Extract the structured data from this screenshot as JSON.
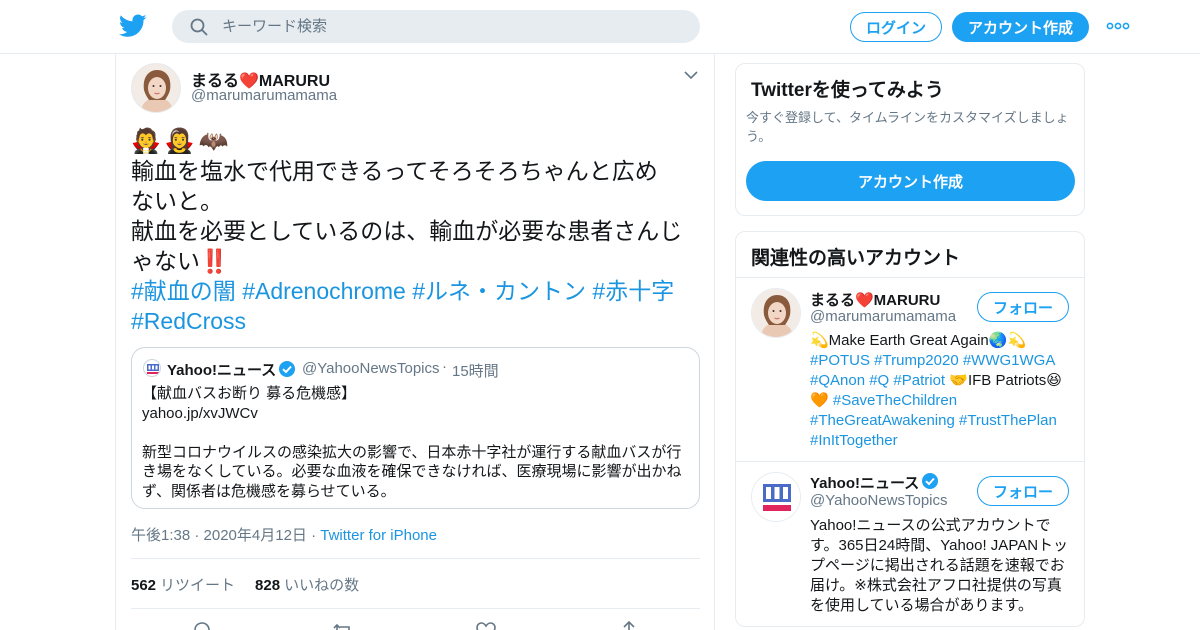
{
  "header": {
    "search_placeholder": "キーワード検索",
    "login_label": "ログイン",
    "signup_label": "アカウント作成",
    "brand_color": "#1da1f2"
  },
  "tweet": {
    "author_name": "まるる❤️MARURU",
    "author_handle": "@marumarumamama",
    "emojis": [
      "🧛",
      "🧛‍♀️",
      "🦇"
    ],
    "text_lines": [
      "輸血を塩水で代用できるってそろそろちゃんと広め",
      "ないと。",
      "献血を必要としているのは、輸血が必要な患者さんじ",
      "ゃない"
    ],
    "exclaim": "‼️",
    "hashtags_line1": [
      "#献血の闇",
      "#Adrenochrome",
      "#ルネ・カントン",
      "#赤十字"
    ],
    "hashtags_line2": [
      "#RedCross"
    ],
    "quote": {
      "name": "Yahoo!ニュース",
      "handle": "@YahooNewsTopics",
      "dot": "·",
      "time": "15時間",
      "body_lines": [
        "【献血バスお断り 募る危機感】",
        "yahoo.jp/xvJWCv",
        "",
        "新型コロナウイルスの感染拡大の影響で、日本赤十字社が運行する献血バスが行",
        "き場をなくしている。必要な血液を確保できなければ、医療現場に影響が出かね",
        "ず、関係者は危機感を募らせている。"
      ]
    },
    "timestamp": "午後1:38 · 2020年4月12日 · ",
    "source": "Twitter for iPhone",
    "retweets": "562",
    "retweets_label": "リツイート",
    "likes": "828",
    "likes_label": "いいねの数"
  },
  "sidebar": {
    "try_card": {
      "title": "Twitterを使ってみよう",
      "desc": "今すぐ登録して、タイムラインをカスタマイズしましょう。",
      "button": "アカウント作成"
    },
    "related": {
      "title": "関連性の高いアカウント",
      "follow_label": "フォロー",
      "accounts": [
        {
          "name": "まるる❤️MARURU",
          "handle": "@marumarumamama",
          "bio_lines": [
            [
              "💫Make Earth Great Again🌏💫"
            ],
            [
              "#POTUS #Trump2020 #WWG1WGA"
            ],
            [
              "#QAnon #Q #Patriot",
              " 🤝IFB Patriots😆"
            ],
            [
              "🧡 ",
              "#SaveTheChildren"
            ],
            [
              "#TheGreatAwakening #TrustThePlan"
            ],
            [
              "#InItTogether"
            ]
          ]
        },
        {
          "name": "Yahoo!ニュース",
          "handle": "@YahooNewsTopics",
          "bio_lines": [
            "Yahoo!ニュースの公式アカウントで",
            "す。365日24時間、Yahoo! JAPANトッ",
            "プページに掲出される話題を速報でお",
            "届け。※株式会社アフロ社提供の写真",
            "を使用している場合があります。"
          ]
        }
      ]
    }
  }
}
